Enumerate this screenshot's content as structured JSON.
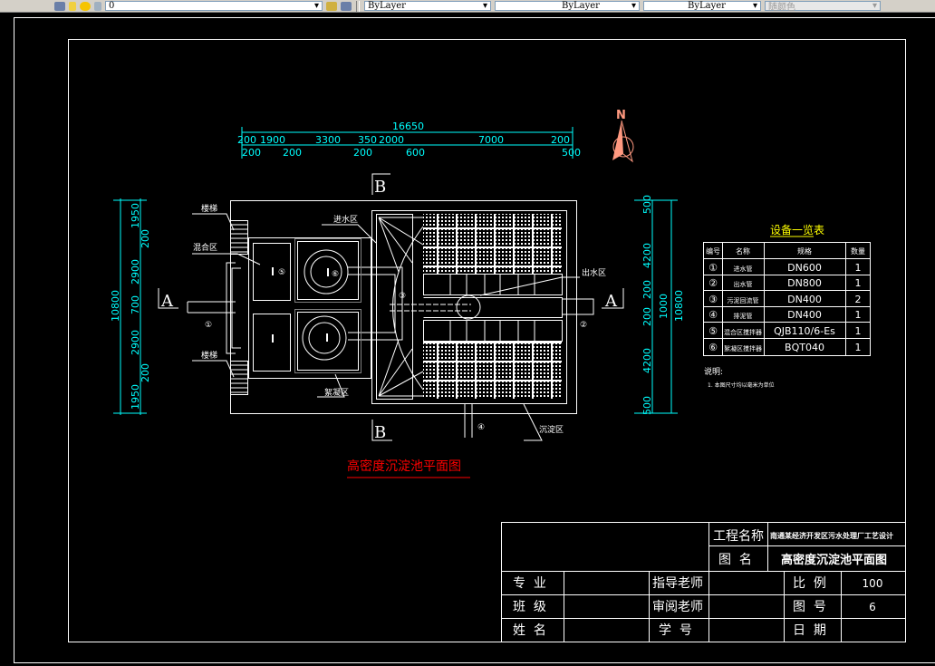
{
  "toolbar": {
    "layer_value": "0",
    "color_value": "ByLayer",
    "linetype_value": "ByLayer",
    "lineweight_value": "ByLayer",
    "plotstyle_value": "随颜色"
  },
  "colors": {
    "background": "#000000",
    "dimension": "#00ffff",
    "title": "#ff0000",
    "north_arrow": "#ff9980",
    "table_title": "#ffff00",
    "lines": "#ffffff"
  },
  "drawing": {
    "title": "高密度沉淀池平面图",
    "north_label": "N",
    "section_marks": {
      "a_left": "A",
      "a_right": "A",
      "b_top": "B",
      "b_bottom": "B"
    },
    "zone_labels": {
      "stairs_top": "楼梯",
      "stairs_bottom": "楼梯",
      "mixing": "混合区",
      "inlet": "进水区",
      "flocculation": "絮凝区",
      "outlet": "出水区",
      "settling": "沉淀区"
    },
    "callouts": [
      "①",
      "②",
      "③",
      "④",
      "⑤",
      "⑥"
    ],
    "dims_top": {
      "total": "16650",
      "row2": [
        "200",
        "1900",
        "3300",
        "350",
        "2000",
        "7000",
        "200"
      ],
      "row3": [
        "200",
        "200",
        "200",
        "600",
        "500"
      ]
    },
    "dims_left": {
      "total": "10800",
      "segments": [
        "1950",
        "2900",
        "700",
        "2900",
        "1950"
      ],
      "sub": [
        "200",
        "200"
      ]
    },
    "dims_right": {
      "total": "10800",
      "segments": [
        "500",
        "4200",
        "200",
        "1000",
        "200",
        "4200",
        "500"
      ]
    }
  },
  "equipment_table": {
    "title": "设备一览表",
    "headers": [
      "编号",
      "名称",
      "规格",
      "数量"
    ],
    "rows": [
      [
        "①",
        "进水管",
        "DN600",
        "1"
      ],
      [
        "②",
        "出水管",
        "DN800",
        "1"
      ],
      [
        "③",
        "污泥回流管",
        "DN400",
        "2"
      ],
      [
        "④",
        "排泥管",
        "DN400",
        "1"
      ],
      [
        "⑤",
        "混合区搅拌器",
        "QJB110/6-Es",
        "1"
      ],
      [
        "⑥",
        "絮凝区搅拌器",
        "BQT040",
        "1"
      ]
    ],
    "notes_title": "说明:",
    "notes": [
      "1. 本图尺寸均以毫米为单位"
    ]
  },
  "title_block": {
    "project_label": "工程名称",
    "project_value": "南通某经济开发区污水处理厂工艺设计",
    "drawing_name_label": "图  名",
    "drawing_name_value": "高密度沉淀池平面图",
    "major_label": "专  业",
    "major_value": "",
    "class_label": "班  级",
    "class_value": "",
    "name_label": "姓  名",
    "name_value": "",
    "advisor_label": "指导老师",
    "advisor_value": "",
    "reviewer_label": "审阅老师",
    "reviewer_value": "",
    "student_no_label": "学  号",
    "student_no_value": "",
    "scale_label": "比  例",
    "scale_value": "100",
    "sheet_no_label": "图  号",
    "sheet_no_value": "6",
    "date_label": "日  期",
    "date_value": ""
  }
}
